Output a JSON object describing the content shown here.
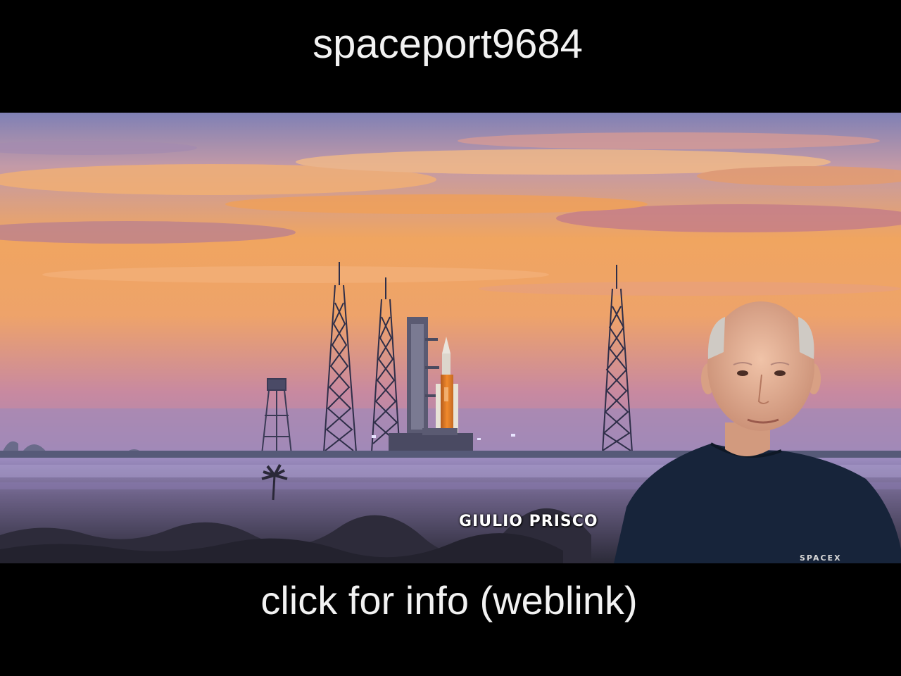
{
  "header": {
    "title": "spaceport9684"
  },
  "scene": {
    "caption": "GIULIO PRISCO",
    "shirt_logo": "SPACEX",
    "colors": {
      "sky_top": "#8a86b8",
      "sky_orange": "#f3a25a",
      "sky_low": "#c98aa6",
      "horizon": "#9c86b8",
      "mist": "#8f7fae",
      "ground": "#2a2a36"
    }
  },
  "footer": {
    "link_text": "click for info (weblink)"
  }
}
